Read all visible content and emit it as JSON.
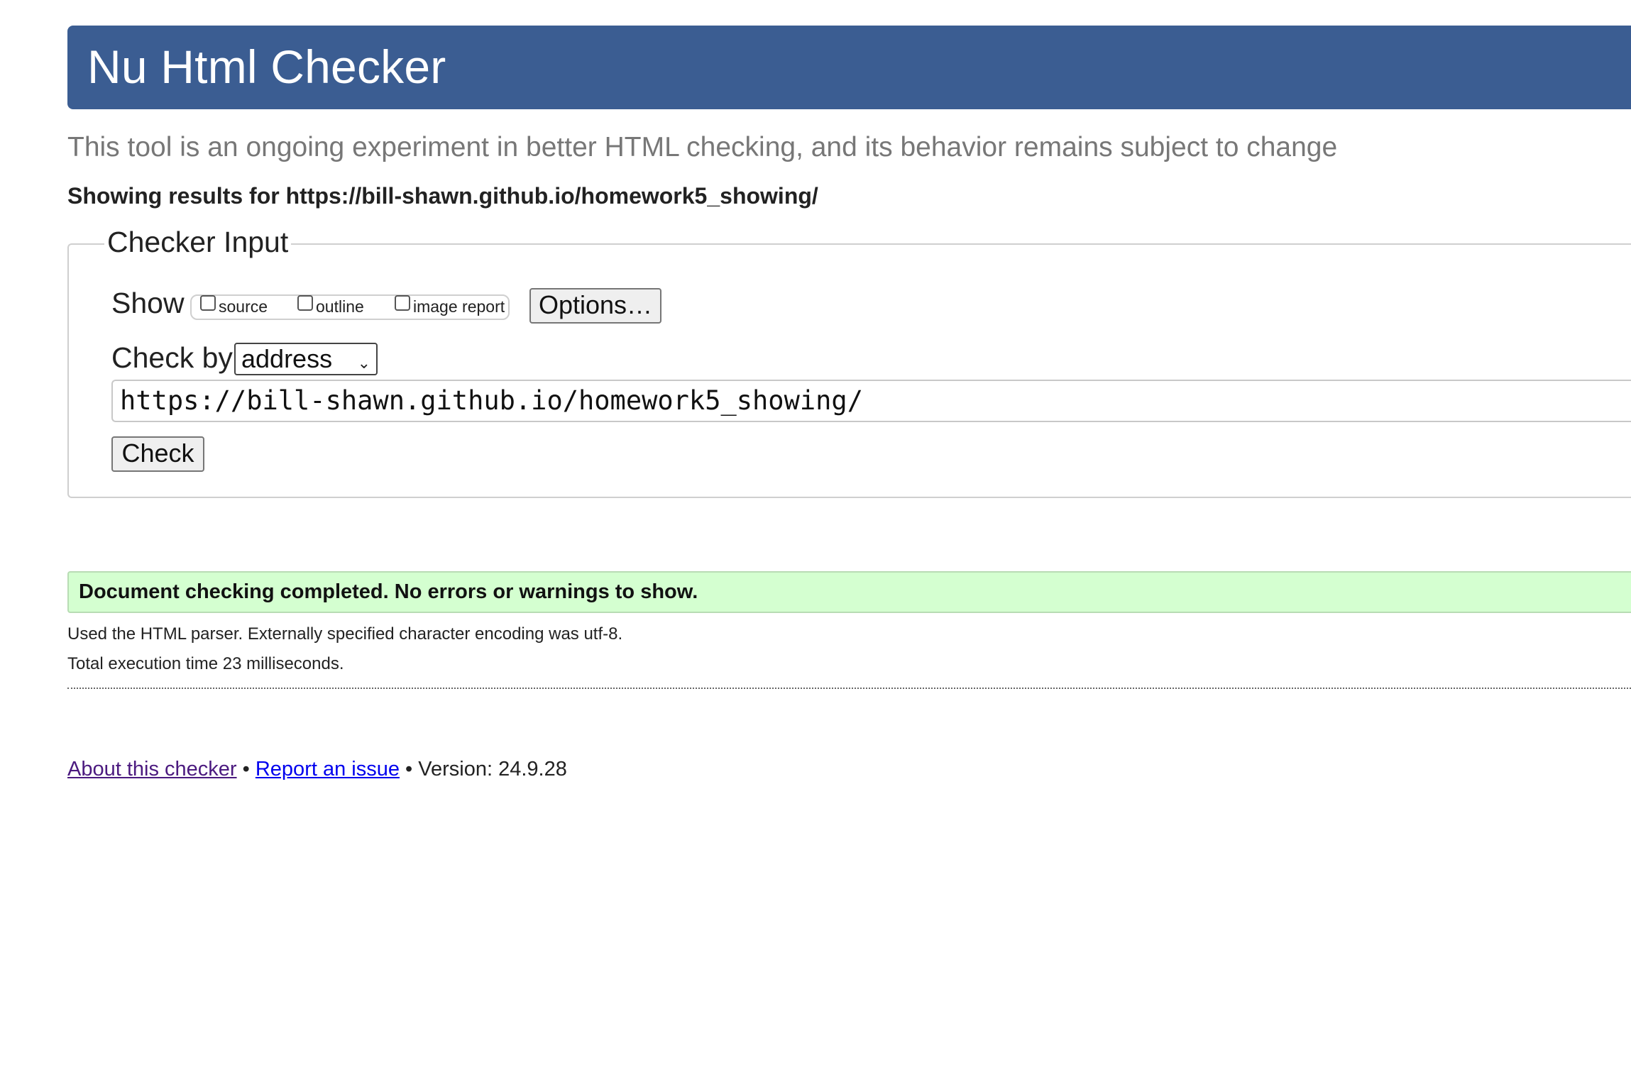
{
  "header": {
    "title": "Nu Html Checker",
    "background_color": "#3b5d92"
  },
  "tagline": "This tool is an ongoing experiment in better HTML checking, and its behavior remains subject to change",
  "results_for": "Showing results for https://bill-shawn.github.io/homework5_showing/",
  "checker_input": {
    "legend": "Checker Input",
    "show_label": "Show",
    "show_options": [
      {
        "label": "source",
        "checked": false
      },
      {
        "label": "outline",
        "checked": false
      },
      {
        "label": "image report",
        "checked": false
      }
    ],
    "options_button": "Options…",
    "check_by_label": "Check by",
    "check_by_value": "address",
    "url_value": "https://bill-shawn.github.io/homework5_showing/",
    "check_button": "Check"
  },
  "result": {
    "message": "Document checking completed. No errors or warnings to show.",
    "background_color": "#d4ffd0",
    "parser_info": "Used the HTML parser. Externally specified character encoding was utf-8.",
    "execution_time": "Total execution time 23 milliseconds."
  },
  "footer": {
    "about_link": "About this checker",
    "separator": "•",
    "report_link": "Report an issue",
    "version": "Version: 24.9.28"
  }
}
